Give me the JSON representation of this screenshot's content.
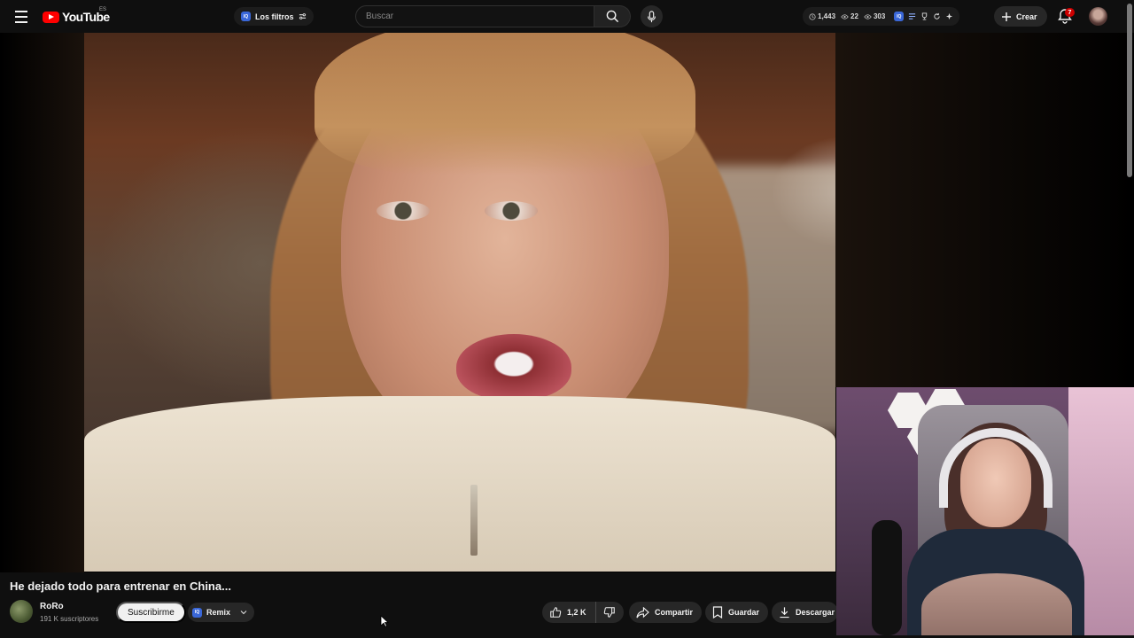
{
  "header": {
    "logo_text": "YouTube",
    "logo_country": "ES",
    "filter_chip_label": "Los filtros",
    "iq_badge": "IQ",
    "search_placeholder": "Buscar",
    "stats": {
      "clock_value": "1,443",
      "eye_value": "22",
      "eye2_value": "303"
    },
    "create_label": "Crear",
    "notifications_count": "7"
  },
  "video": {
    "title": "He dejado todo para entrenar en China..."
  },
  "channel": {
    "name": "RoRo",
    "subscribers": "191 K suscriptores",
    "subscribe_label": "Suscribirme",
    "remix_label": "Remix"
  },
  "actions": {
    "like_count": "1,2 K",
    "share_label": "Compartir",
    "save_label": "Guardar",
    "download_label": "Descargar"
  },
  "colors": {
    "background": "#0f0f0f",
    "brand_red": "#ff0000",
    "pill_bg": "#272727",
    "iq_blue": "#3a67d8"
  },
  "icons": [
    "menu-icon",
    "youtube-logo-icon",
    "filter-icon",
    "search-icon",
    "mic-icon",
    "clock-icon",
    "eye-icon",
    "plus-icon",
    "bell-icon",
    "like-icon",
    "dislike-icon",
    "share-icon",
    "save-icon",
    "download-icon",
    "chevron-down-icon"
  ]
}
